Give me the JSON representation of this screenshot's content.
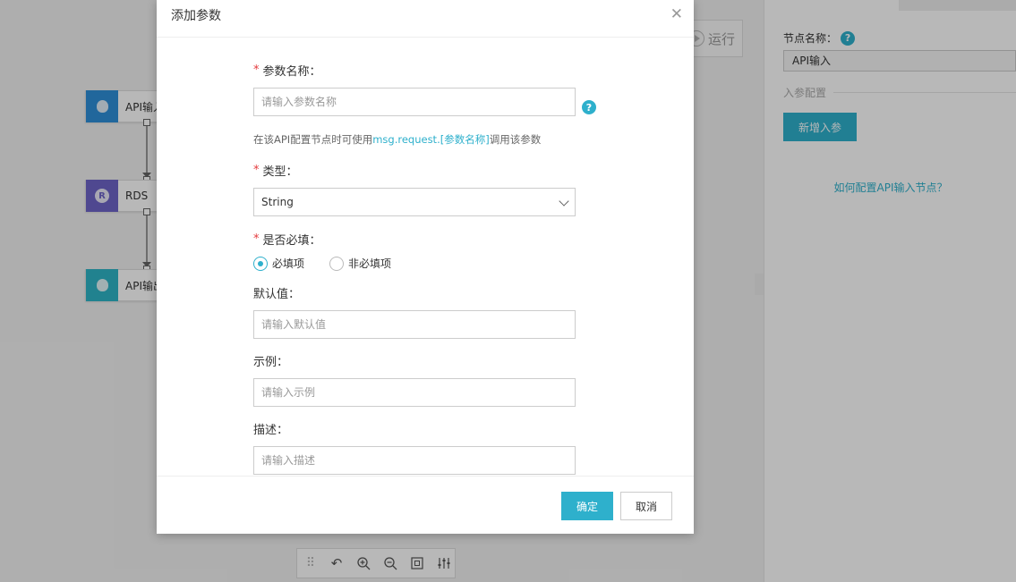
{
  "canvas": {
    "run_label": "运行",
    "nodes": [
      {
        "label": "API输入",
        "icon": "api-input-icon"
      },
      {
        "label": "RDS",
        "icon_letter": "R",
        "icon": "rds-icon"
      },
      {
        "label": "API输出",
        "icon": "api-output-icon"
      }
    ],
    "toolbar": [
      "drag-handle-icon",
      "undo-icon",
      "zoom-in-icon",
      "zoom-out-icon",
      "fit-screen-icon",
      "settings-sliders-icon"
    ]
  },
  "right_panel": {
    "node_name_label": "节点名称：",
    "node_name_value": "API输入",
    "section_label": "入参配置",
    "add_button": "新增入参",
    "help_link": "如何配置API输入节点？"
  },
  "modal": {
    "title": "添加参数",
    "fields": {
      "name": {
        "label": "参数名称：",
        "placeholder": "请输入参数名称"
      },
      "hint_prefix": "在该API配置节点时可使用",
      "hint_highlight": "msg.request.[参数名称]",
      "hint_suffix": "调用该参数",
      "type": {
        "label": "类型：",
        "value": "String"
      },
      "required": {
        "label": "是否必填：",
        "options": [
          "必填项",
          "非必填项"
        ],
        "selected": "必填项"
      },
      "default": {
        "label": "默认值：",
        "placeholder": "请输入默认值"
      },
      "example": {
        "label": "示例：",
        "placeholder": "请输入示例"
      },
      "description": {
        "label": "描述：",
        "placeholder": "请输入描述"
      }
    },
    "ok_label": "确定",
    "cancel_label": "取消"
  },
  "colors": {
    "accent": "#2eb0cc",
    "required": "#e4393c"
  }
}
